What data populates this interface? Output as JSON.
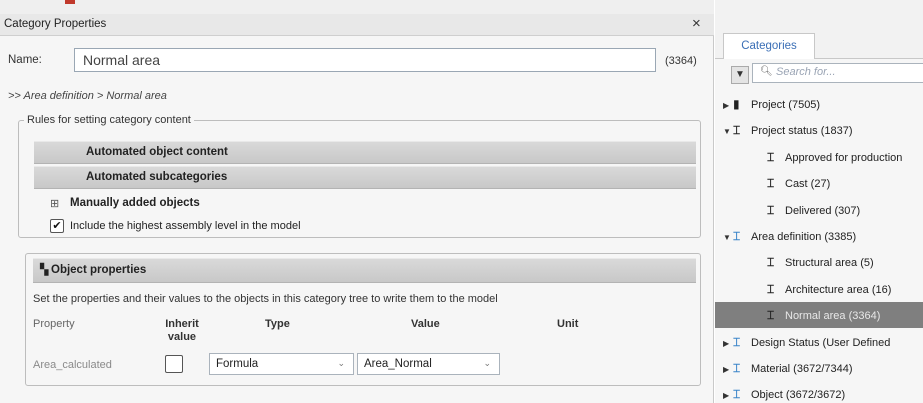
{
  "dialog": {
    "title": "Category Properties",
    "close_icon": "×",
    "name_label": "Name:",
    "name_value": "Normal area",
    "name_count": "(3364)",
    "breadcrumb": ">> Area definition > Normal area",
    "rules_legend": "Rules for setting category content",
    "automated_object_content": "Automated object content",
    "automated_subcategories": "Automated subcategories",
    "manually_added_objects": "Manually added objects",
    "include_highest_assembly": "Include the highest assembly level in the model",
    "object_properties": "Object properties",
    "object_properties_desc": "Set the properties and their values to the objects in this category tree to write them to the model",
    "table_headers": {
      "property": "Property",
      "inherit_value": "Inherit value",
      "type": "Type",
      "value": "Value",
      "unit": "Unit"
    },
    "rows": [
      {
        "property": "Area_calculated",
        "inherit": false,
        "type": "Formula",
        "value": "Area_Normal",
        "unit": ""
      }
    ]
  },
  "right_panel": {
    "tab": "Categories",
    "search_placeholder": "Search for...",
    "tree": [
      {
        "label": "Project (7505)",
        "level": 0,
        "expanded": false,
        "icon": "book-icon",
        "icon_color": "dark"
      },
      {
        "label": "Project status (1837)",
        "level": 0,
        "expanded": true,
        "icon": "category-tree-icon",
        "icon_color": "dark"
      },
      {
        "label": "Approved for production",
        "level": 1,
        "icon": "category-tree-icon",
        "icon_color": "dark"
      },
      {
        "label": "Cast (27)",
        "level": 1,
        "icon": "category-tree-icon",
        "icon_color": "dark"
      },
      {
        "label": "Delivered (307)",
        "level": 1,
        "icon": "category-tree-icon",
        "icon_color": "dark"
      },
      {
        "label": "Area definition (3385)",
        "level": 0,
        "expanded": true,
        "icon": "category-tree-icon",
        "icon_color": "blue"
      },
      {
        "label": "Structural area (5)",
        "level": 1,
        "icon": "category-tree-icon",
        "icon_color": "dark"
      },
      {
        "label": "Architecture area (16)",
        "level": 1,
        "icon": "category-tree-icon",
        "icon_color": "dark"
      },
      {
        "label": "Normal area (3364)",
        "level": 1,
        "icon": "category-tree-icon",
        "icon_color": "dark",
        "selected": true
      },
      {
        "label": "Design Status (User Defined",
        "level": 0,
        "expanded": false,
        "icon": "category-tree-icon",
        "icon_color": "blue"
      },
      {
        "label": "Material (3672/7344)",
        "level": 0,
        "expanded": false,
        "icon": "category-tree-icon",
        "icon_color": "blue"
      },
      {
        "label": "Object (3672/3672)",
        "level": 0,
        "expanded": false,
        "icon": "category-tree-icon",
        "icon_color": "blue"
      }
    ]
  },
  "colors": {
    "selection": "#7f7f7f",
    "tab_text": "#3b6fb6",
    "blue_icon": "#3b86c9"
  }
}
